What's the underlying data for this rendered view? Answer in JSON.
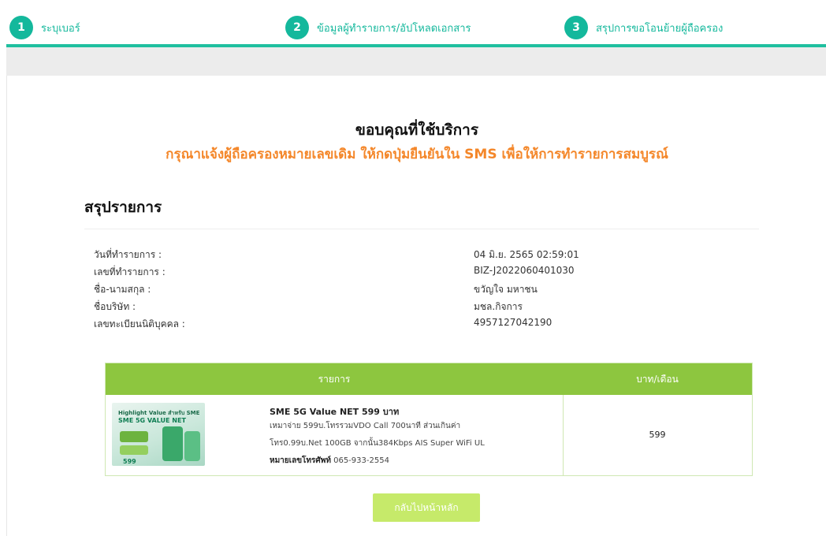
{
  "stepper": {
    "steps": [
      {
        "number": "1",
        "label": "ระบุเบอร์"
      },
      {
        "number": "2",
        "label": "ข้อมูลผู้ทำรายการ/อัปโหลดเอกสาร"
      },
      {
        "number": "3",
        "label": "สรุปการขอโอนย้ายผู้ถือครอง"
      }
    ],
    "accent_color": "#14b89c"
  },
  "main": {
    "thanks_text": "ขอบคุณที่ใช้บริการ",
    "notice_text": "กรุณาแจ้งผู้ถือครองหมายเลขเดิม ให้กดปุ่มยืนยันใน SMS เพื่อให้การทำรายการสมบูรณ์",
    "notice_color": "#f4872a",
    "summary_title": "สรุปรายการ",
    "info": [
      {
        "label": "วันที่ทำรายการ :",
        "value": "04 มิ.ย. 2565 02:59:01"
      },
      {
        "label": "เลขที่ทำรายการ :",
        "value": "BIZ-J2022060401030"
      },
      {
        "label": "ชื่อ-นามสกุล :",
        "value": "ขวัญใจ มหาชน"
      },
      {
        "label": "ชื่อบริษัท :",
        "value": "มชล.กิจการ"
      },
      {
        "label": "เลขทะเบียนนิติบุคคล :",
        "value": "4957127042190"
      }
    ],
    "table": {
      "header_item": "รายการ",
      "header_price": "บาท/เดือน",
      "header_color": "#8dc63f",
      "row": {
        "name": "SME 5G Value NET 599 บาท",
        "desc_line1": "เหมาจ่าย 599บ.โทรรวมVDO Call 700นาที ส่วนเกินค่า",
        "desc_line2": "โทร0.99บ.Net 100GB จากนั้น384Kbps AIS Super WiFi UL",
        "phone_label": "หมายเลขโทรศัพท์",
        "phone_value": "065-933-2554",
        "price": "599",
        "image": {
          "badge": "Highlight Value สำหรับ SME",
          "title": "SME 5G VALUE NET",
          "price_tag": "599"
        }
      }
    },
    "home_button": "กลับไปหน้าหลัก",
    "home_button_color": "#c6ea6a"
  }
}
